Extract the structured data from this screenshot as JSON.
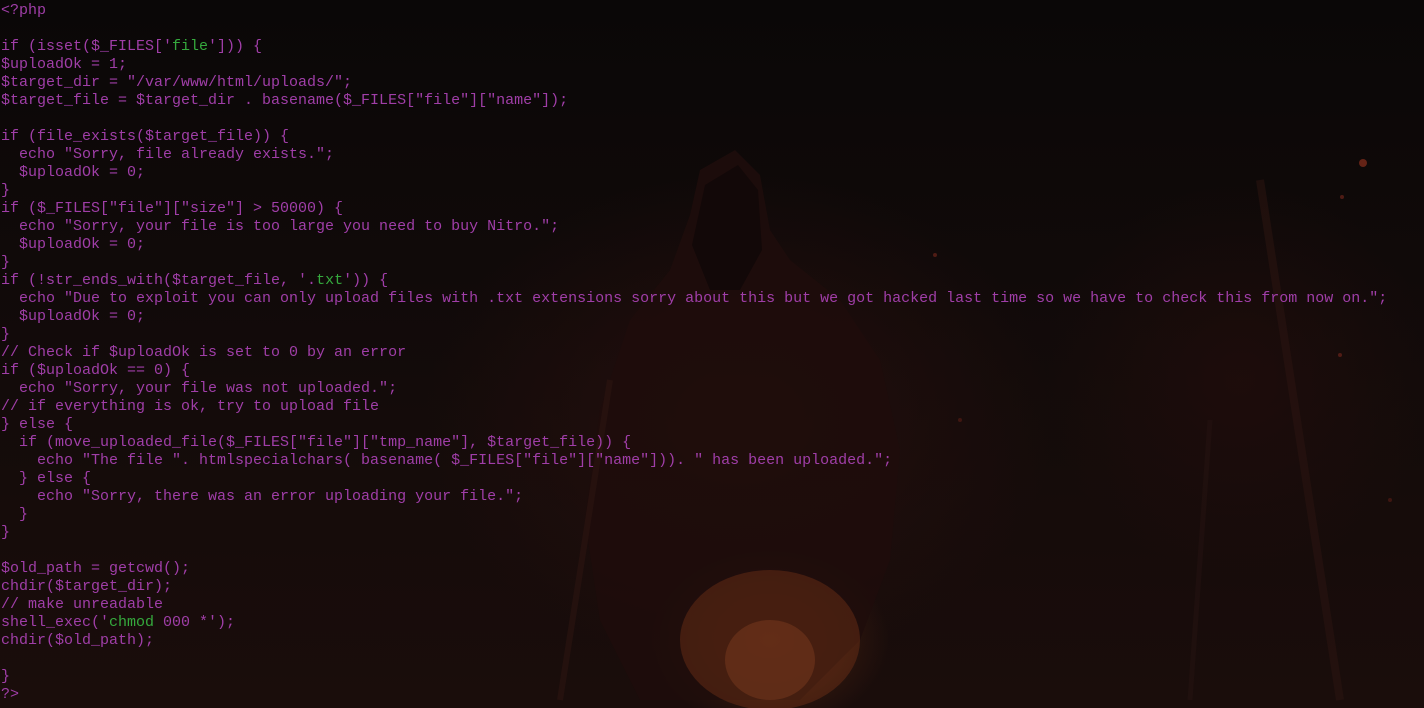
{
  "theme": {
    "background": "#0b0707",
    "text_color": "#a03ea8",
    "string_highlight_color": "#35a93d"
  },
  "code": {
    "language": "php",
    "lines": [
      [
        {
          "t": "<?php",
          "c": "plain"
        }
      ],
      [],
      [
        {
          "t": "if (isset($_FILES['",
          "c": "plain"
        },
        {
          "t": "file",
          "c": "grn"
        },
        {
          "t": "'])) {",
          "c": "plain"
        }
      ],
      [
        {
          "t": "$uploadOk = 1;",
          "c": "plain"
        }
      ],
      [
        {
          "t": "$target_dir = \"/var/www/html/uploads/\";",
          "c": "plain"
        }
      ],
      [
        {
          "t": "$target_file = $target_dir . basename($_FILES[\"file\"][\"name\"]);",
          "c": "plain"
        }
      ],
      [],
      [
        {
          "t": "if (file_exists($target_file)) {",
          "c": "plain"
        }
      ],
      [
        {
          "t": "  echo \"Sorry, file already exists.\";",
          "c": "plain"
        }
      ],
      [
        {
          "t": "  $uploadOk = 0;",
          "c": "plain"
        }
      ],
      [
        {
          "t": "}",
          "c": "plain"
        }
      ],
      [
        {
          "t": "if ($_FILES[\"file\"][\"size\"] > 50000) {",
          "c": "plain"
        }
      ],
      [
        {
          "t": "  echo \"Sorry, your file is too large you need to buy Nitro.\";",
          "c": "plain"
        }
      ],
      [
        {
          "t": "  $uploadOk = 0;",
          "c": "plain"
        }
      ],
      [
        {
          "t": "}",
          "c": "plain"
        }
      ],
      [
        {
          "t": "if (!str_ends_with($target_file, '.",
          "c": "plain"
        },
        {
          "t": "txt",
          "c": "grn"
        },
        {
          "t": "')) {",
          "c": "plain"
        }
      ],
      [
        {
          "t": "  echo \"Due to exploit you can only upload files with .txt extensions sorry about this but we got hacked last time so we have to check this from now on.\";",
          "c": "plain"
        }
      ],
      [
        {
          "t": "  $uploadOk = 0;",
          "c": "plain"
        }
      ],
      [
        {
          "t": "}",
          "c": "plain"
        }
      ],
      [
        {
          "t": "// Check if $uploadOk is set to 0 by an error",
          "c": "plain"
        }
      ],
      [
        {
          "t": "if ($uploadOk == 0) {",
          "c": "plain"
        }
      ],
      [
        {
          "t": "  echo \"Sorry, your file was not uploaded.\";",
          "c": "plain"
        }
      ],
      [
        {
          "t": "// if everything is ok, try to upload file",
          "c": "plain"
        }
      ],
      [
        {
          "t": "} else {",
          "c": "plain"
        }
      ],
      [
        {
          "t": "  if (move_uploaded_file($_FILES[\"file\"][\"tmp_name\"], $target_file)) {",
          "c": "plain"
        }
      ],
      [
        {
          "t": "    echo \"The file \". htmlspecialchars( basename( $_FILES[\"file\"][\"name\"])). \" has been uploaded.\";",
          "c": "plain"
        }
      ],
      [
        {
          "t": "  } else {",
          "c": "plain"
        }
      ],
      [
        {
          "t": "    echo \"Sorry, there was an error uploading your file.\";",
          "c": "plain"
        }
      ],
      [
        {
          "t": "  }",
          "c": "plain"
        }
      ],
      [
        {
          "t": "}",
          "c": "plain"
        }
      ],
      [],
      [
        {
          "t": "$old_path = getcwd();",
          "c": "plain"
        }
      ],
      [
        {
          "t": "chdir($target_dir);",
          "c": "plain"
        }
      ],
      [
        {
          "t": "// make unreadable",
          "c": "plain"
        }
      ],
      [
        {
          "t": "shell_exec('",
          "c": "plain"
        },
        {
          "t": "chmod",
          "c": "grn"
        },
        {
          "t": " 000 *');",
          "c": "plain"
        }
      ],
      [
        {
          "t": "chdir($old_path);",
          "c": "plain"
        }
      ],
      [],
      [
        {
          "t": "}",
          "c": "plain"
        }
      ],
      [
        {
          "t": "?>",
          "c": "plain"
        }
      ]
    ]
  }
}
